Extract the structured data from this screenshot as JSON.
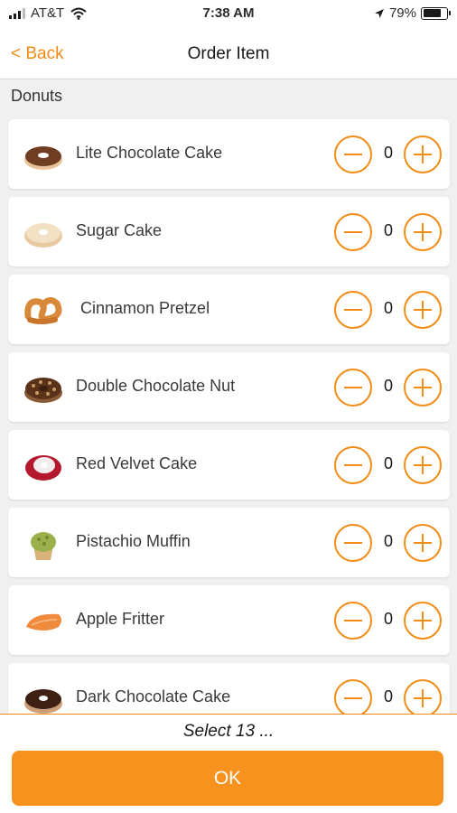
{
  "status_bar": {
    "carrier": "AT&T",
    "time": "7:38 AM",
    "battery": "79%",
    "battery_level": 0.79
  },
  "nav": {
    "back_label": "< Back",
    "title": "Order Item"
  },
  "section": {
    "title": "Donuts"
  },
  "items": [
    {
      "name": "Lite Chocolate Cake",
      "qty": "0",
      "icon": "chocolate-donut-icon"
    },
    {
      "name": "Sugar Cake",
      "qty": "0",
      "icon": "sugar-donut-icon"
    },
    {
      "name": " Cinnamon Pretzel",
      "qty": "0",
      "icon": "pretzel-icon"
    },
    {
      "name": "Double Chocolate Nut",
      "qty": "0",
      "icon": "nut-donut-icon"
    },
    {
      "name": "Red Velvet Cake",
      "qty": "0",
      "icon": "red-velvet-donut-icon"
    },
    {
      "name": "Pistachio Muffin",
      "qty": "0",
      "icon": "muffin-icon"
    },
    {
      "name": "Apple Fritter",
      "qty": "0",
      "icon": "fritter-icon"
    },
    {
      "name": "Dark Chocolate Cake",
      "qty": "0",
      "icon": "dark-chocolate-donut-icon"
    }
  ],
  "footer": {
    "select_text": "Select 13 ...",
    "ok_label": "OK"
  },
  "colors": {
    "accent": "#f28c16",
    "ok_button": "#f7921e",
    "background": "#f0f0f0"
  }
}
